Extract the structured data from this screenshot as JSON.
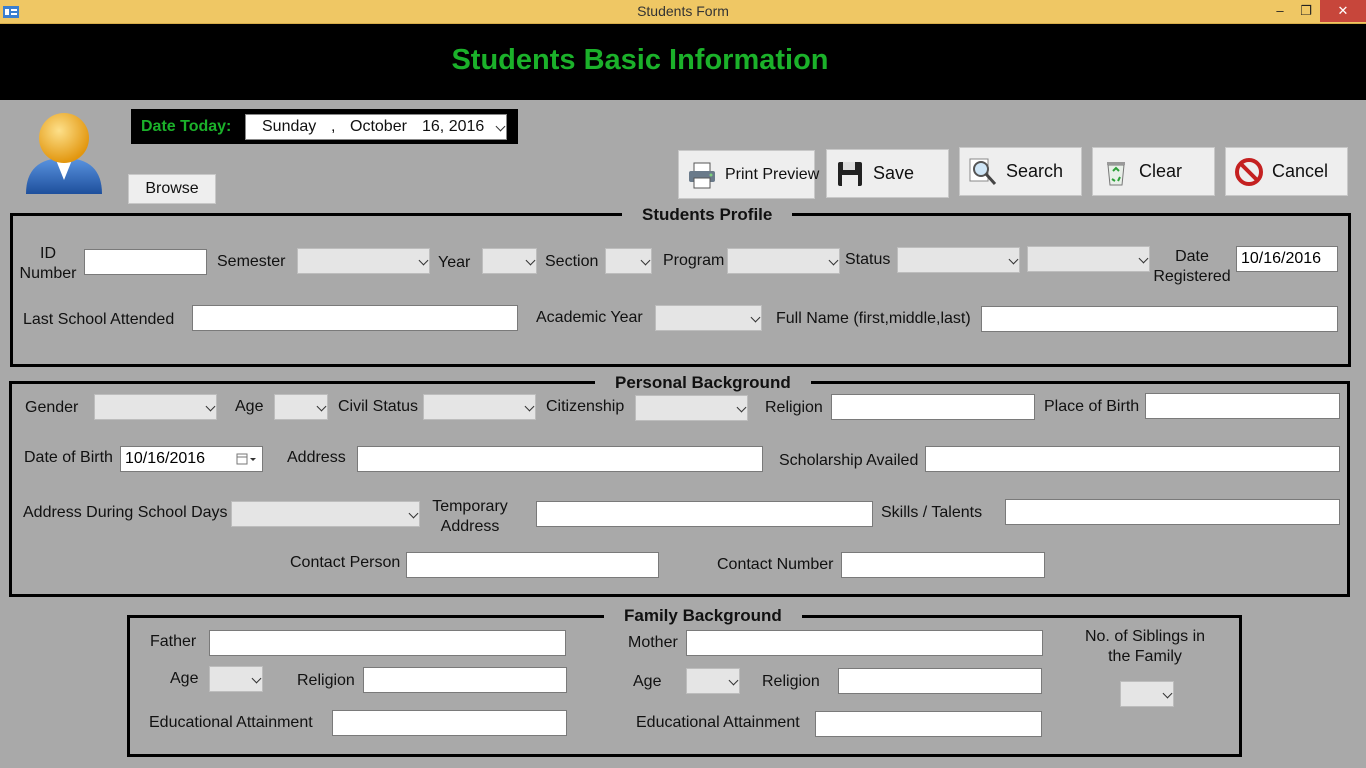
{
  "window": {
    "title": "Students Form",
    "minimize": "–",
    "maximize": "❐",
    "close": "✕"
  },
  "header": {
    "title": "Students Basic Information"
  },
  "date_today": {
    "label": "Date Today:",
    "day": "Sunday",
    "sep": ",",
    "month": "October",
    "date": "16, 2016"
  },
  "toolbar": {
    "browse": "Browse",
    "print_preview": "Print Preview",
    "save": "Save",
    "search": "Search",
    "clear": "Clear",
    "cancel": "Cancel"
  },
  "students_profile": {
    "title": "Students Profile",
    "id_number": "ID Number",
    "semester": "Semester",
    "year": "Year",
    "section": "Section",
    "program": "Program",
    "status": "Status",
    "date_registered": "Date Registered",
    "date_registered_value": "10/16/2016",
    "last_school": "Last School Attended",
    "academic_year": "Academic Year",
    "full_name": "Full Name (first,middle,last)"
  },
  "personal": {
    "title": "Personal Background",
    "gender": "Gender",
    "age": "Age",
    "civil_status": "Civil Status",
    "citizenship": "Citizenship",
    "religion": "Religion",
    "place_of_birth": "Place of Birth",
    "date_of_birth": "Date of Birth",
    "date_of_birth_value": "10/16/2016",
    "address": "Address",
    "scholarship": "Scholarship Availed",
    "address_school_days": "Address During School Days",
    "temporary_address": "Temporary Address",
    "skills": "Skills / Talents",
    "contact_person": "Contact Person",
    "contact_number": "Contact Number"
  },
  "family": {
    "title": "Family Background",
    "father": "Father",
    "mother": "Mother",
    "age": "Age",
    "religion": "Religion",
    "educational_attainment": "Educational Attainment",
    "siblings": "No. of Siblings in the Family"
  },
  "colors": {
    "titlebar": "#efc764",
    "header_bg": "#000000",
    "header_text": "#1bb12a",
    "form_bg": "#a9a9a9"
  }
}
